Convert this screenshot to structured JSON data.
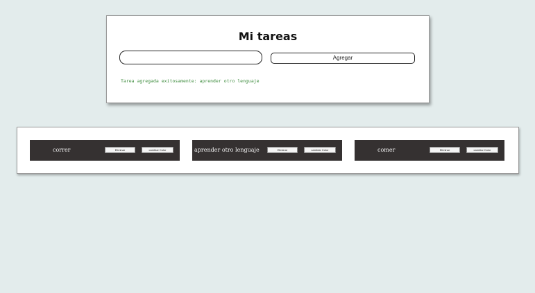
{
  "header": {
    "title": "Mi tareas",
    "input_value": "",
    "add_label": "Agregar",
    "status_message": "Tarea agregada exitosamente: aprender otro lenguaje"
  },
  "tasks": [
    {
      "name": "correr",
      "delete_label": "Eliminar",
      "color_label": "cambiar Color"
    },
    {
      "name": "aprender otro lenguaje",
      "delete_label": "Eliminar",
      "color_label": "cambiar Color"
    },
    {
      "name": "comer",
      "delete_label": "Eliminar",
      "color_label": "cambiar Color"
    }
  ],
  "colors": {
    "background": "#e3ecec",
    "task_background": "#353131",
    "status_text": "#3a8a3a"
  }
}
